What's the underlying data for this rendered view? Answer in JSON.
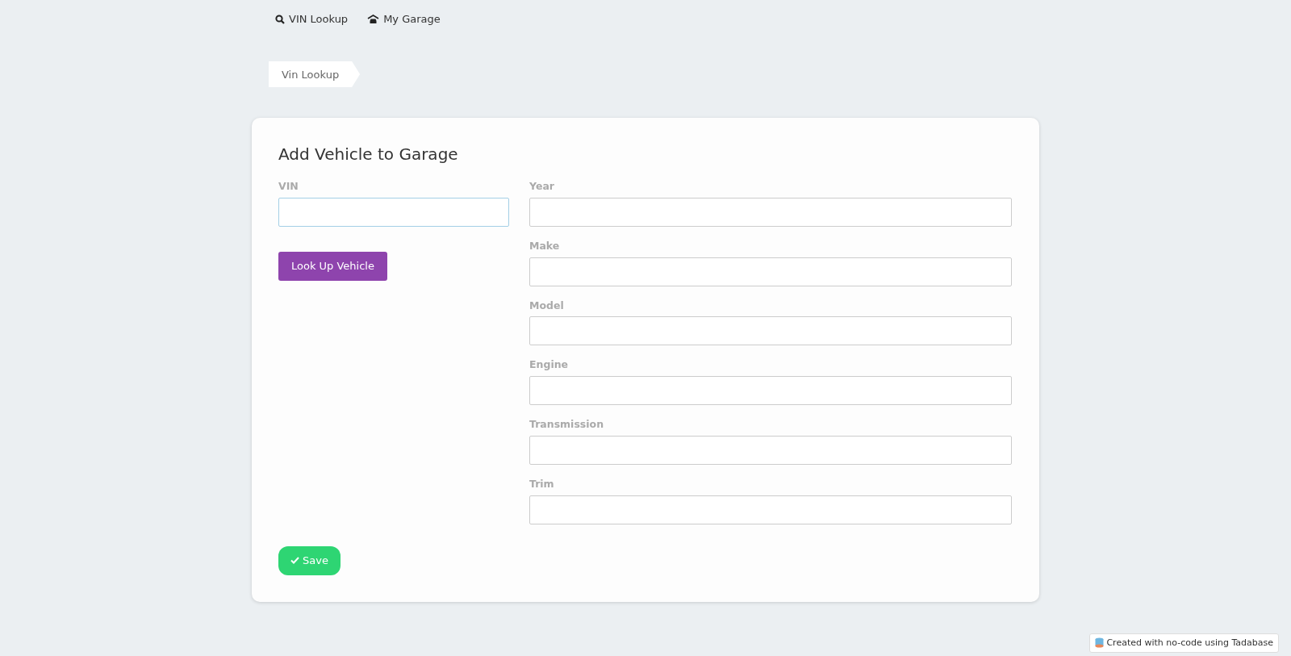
{
  "nav": [
    {
      "kind": "search",
      "label": "VIN Lookup"
    },
    {
      "kind": "garage",
      "label": "My Garage"
    }
  ],
  "breadcrumb": "Vin Lookup",
  "form": {
    "title": "Add Vehicle to Garage",
    "vin": {
      "label": "VIN",
      "focused": true
    },
    "lookup_button": "Look Up Vehicle",
    "fields": [
      {
        "label": "Year",
        "focused": false
      },
      {
        "label": "Make",
        "focused": false
      },
      {
        "label": "Model",
        "focused": false
      },
      {
        "label": "Engine",
        "focused": false
      },
      {
        "label": "Transmission",
        "focused": false
      },
      {
        "label": "Trim",
        "focused": false
      }
    ],
    "save_button": "Save"
  },
  "footer_badge": "Created with no-code using Tadabase"
}
